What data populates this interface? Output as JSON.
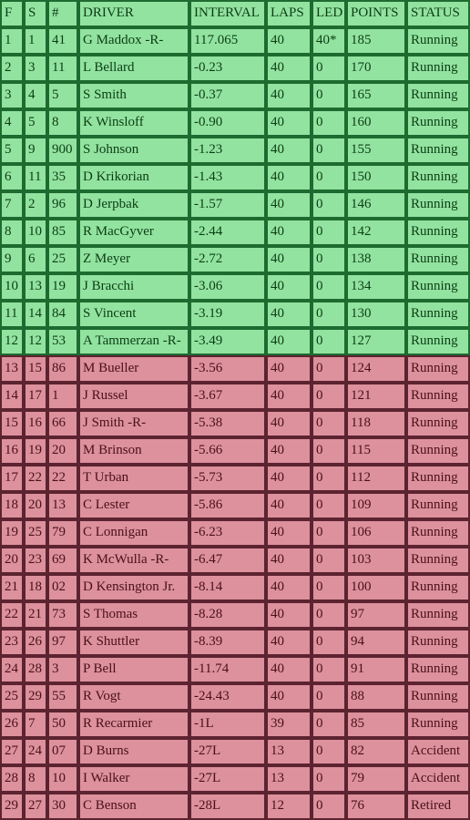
{
  "colors": {
    "green_cell": "#92e3a0",
    "green_border": "#1e6b30",
    "red_cell": "#dc919d",
    "red_border": "#5c2330"
  },
  "headers": [
    "F",
    "S",
    "#",
    "DRIVER",
    "INTERVAL",
    "LAPS",
    "LED",
    "POINTS",
    "STATUS"
  ],
  "rows": [
    [
      "1",
      "1",
      "41",
      "G Maddox -R-",
      "117.065",
      "40",
      "40*",
      "185",
      "Running"
    ],
    [
      "2",
      "3",
      "11",
      "L Bellard",
      "-0.23",
      "40",
      "0",
      "170",
      "Running"
    ],
    [
      "3",
      "4",
      "5",
      "S Smith",
      "-0.37",
      "40",
      "0",
      "165",
      "Running"
    ],
    [
      "4",
      "5",
      "8",
      "K Winsloff",
      "-0.90",
      "40",
      "0",
      "160",
      "Running"
    ],
    [
      "5",
      "9",
      "900",
      "S Johnson",
      "-1.23",
      "40",
      "0",
      "155",
      "Running"
    ],
    [
      "6",
      "11",
      "35",
      "D Krikorian",
      "-1.43",
      "40",
      "0",
      "150",
      "Running"
    ],
    [
      "7",
      "2",
      "96",
      "D Jerpbak",
      "-1.57",
      "40",
      "0",
      "146",
      "Running"
    ],
    [
      "8",
      "10",
      "85",
      "R MacGyver",
      "-2.44",
      "40",
      "0",
      "142",
      "Running"
    ],
    [
      "9",
      "6",
      "25",
      "Z Meyer",
      "-2.72",
      "40",
      "0",
      "138",
      "Running"
    ],
    [
      "10",
      "13",
      "19",
      "J Bracchi",
      "-3.06",
      "40",
      "0",
      "134",
      "Running"
    ],
    [
      "11",
      "14",
      "84",
      "S Vincent",
      "-3.19",
      "40",
      "0",
      "130",
      "Running"
    ],
    [
      "12",
      "12",
      "53",
      "A Tammerzan -R-",
      "-3.49",
      "40",
      "0",
      "127",
      "Running"
    ],
    [
      "13",
      "15",
      "86",
      "M Bueller",
      "-3.56",
      "40",
      "0",
      "124",
      "Running"
    ],
    [
      "14",
      "17",
      "1",
      "J Russel",
      "-3.67",
      "40",
      "0",
      "121",
      "Running"
    ],
    [
      "15",
      "16",
      "66",
      "J Smith -R-",
      "-5.38",
      "40",
      "0",
      "118",
      "Running"
    ],
    [
      "16",
      "19",
      "20",
      "M Brinson",
      "-5.66",
      "40",
      "0",
      "115",
      "Running"
    ],
    [
      "17",
      "22",
      "22",
      "T Urban",
      "-5.73",
      "40",
      "0",
      "112",
      "Running"
    ],
    [
      "18",
      "20",
      "13",
      "C Lester",
      "-5.86",
      "40",
      "0",
      "109",
      "Running"
    ],
    [
      "19",
      "25",
      "79",
      "C Lonnigan",
      "-6.23",
      "40",
      "0",
      "106",
      "Running"
    ],
    [
      "20",
      "23",
      "69",
      "K McWulla -R-",
      "-6.47",
      "40",
      "0",
      "103",
      "Running"
    ],
    [
      "21",
      "18",
      "02",
      "D Kensington Jr.",
      "-8.14",
      "40",
      "0",
      "100",
      "Running"
    ],
    [
      "22",
      "21",
      "73",
      "S Thomas",
      "-8.28",
      "40",
      "0",
      "97",
      "Running"
    ],
    [
      "23",
      "26",
      "97",
      "K Shuttler",
      "-8.39",
      "40",
      "0",
      "94",
      "Running"
    ],
    [
      "24",
      "28",
      "3",
      "P Bell",
      "-11.74",
      "40",
      "0",
      "91",
      "Running"
    ],
    [
      "25",
      "29",
      "55",
      "R Vogt",
      "-24.43",
      "40",
      "0",
      "88",
      "Running"
    ],
    [
      "26",
      "7",
      "50",
      "R Recarmier",
      "-1L",
      "39",
      "0",
      "85",
      "Running"
    ],
    [
      "27",
      "24",
      "07",
      "D Burns",
      "-27L",
      "13",
      "0",
      "82",
      "Accident"
    ],
    [
      "28",
      "8",
      "10",
      "I Walker",
      "-27L",
      "13",
      "0",
      "79",
      "Accident"
    ],
    [
      "29",
      "27",
      "30",
      "C Benson",
      "-28L",
      "12",
      "0",
      "76",
      "Retired"
    ]
  ]
}
